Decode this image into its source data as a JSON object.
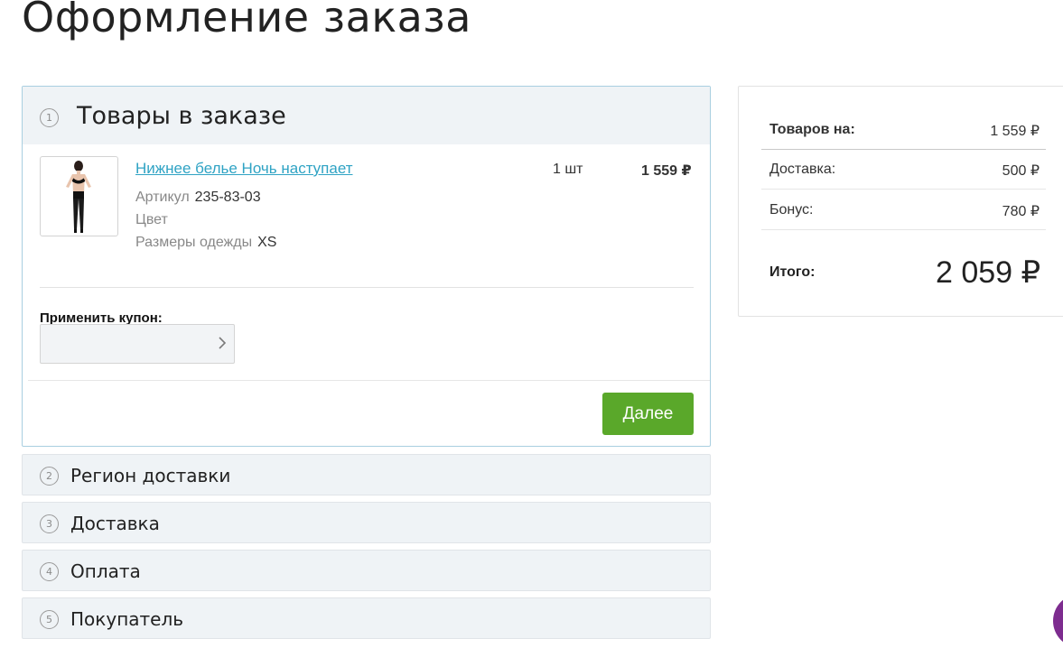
{
  "page": {
    "title": "Оформление заказа"
  },
  "order_items": {
    "step": "1",
    "title": "Товары в заказе",
    "product": {
      "name": "Нижнее белье Ночь наступает",
      "article_label": "Артикул",
      "article_value": "235-83-03",
      "color_label": "Цвет",
      "size_label": "Размеры одежды",
      "size_value": "XS",
      "quantity": "1 шт",
      "price": "1 559 ₽"
    },
    "coupon": {
      "label": "Применить купон:",
      "placeholder": ""
    },
    "next_button": "Далее"
  },
  "steps": [
    {
      "num": "2",
      "title": "Регион доставки"
    },
    {
      "num": "3",
      "title": "Доставка"
    },
    {
      "num": "4",
      "title": "Оплата"
    },
    {
      "num": "5",
      "title": "Покупатель"
    }
  ],
  "summary": {
    "goods_label": "Товаров на:",
    "goods_value": "1 559 ₽",
    "delivery_label": "Доставка:",
    "delivery_value": "500 ₽",
    "bonus_label": "Бонус:",
    "bonus_value": "780 ₽",
    "total_label": "Итого:",
    "total_value": "2 059 ₽"
  },
  "colors": {
    "accent_green": "#5aa82a",
    "link": "#2fa3c4",
    "panel_bg": "#eff3f6",
    "chat": "#7d2c8f"
  }
}
